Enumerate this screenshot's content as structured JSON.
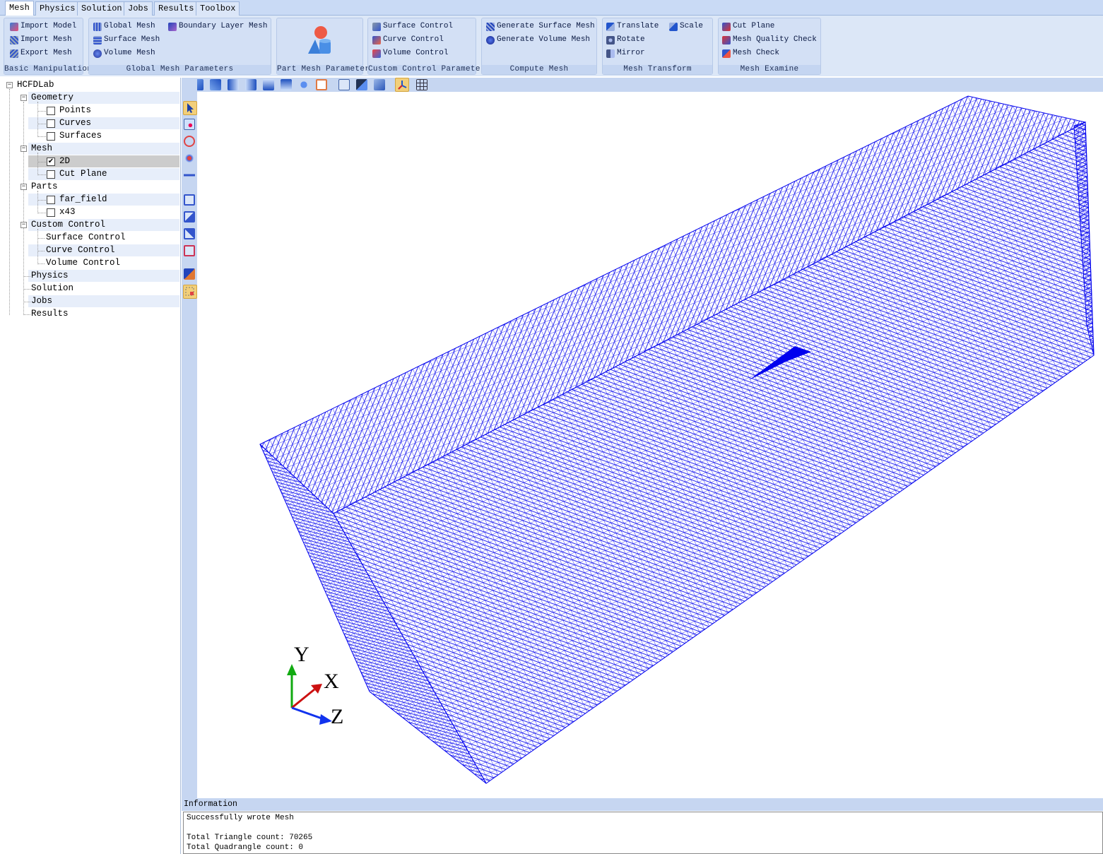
{
  "tabs": [
    "Mesh",
    "Physics",
    "Solution",
    "Jobs",
    "Results",
    "Toolbox"
  ],
  "ribbon": {
    "basic": {
      "title": "Basic Manipulation",
      "import_model": "Import Model",
      "import_mesh": "Import Mesh",
      "export_mesh": "Export Mesh"
    },
    "global": {
      "title": "Global Mesh Parameters",
      "global_mesh": "Global Mesh",
      "boundary_layer_mesh": "Boundary Layer Mesh",
      "surface_mesh": "Surface Mesh",
      "volume_mesh": "Volume Mesh"
    },
    "part": {
      "title": "Part Mesh Parameters"
    },
    "custom": {
      "title": "Custom Control Parameters",
      "surface_control": "Surface Control",
      "curve_control": "Curve Control",
      "volume_control": "Volume Control"
    },
    "compute": {
      "title": "Compute Mesh",
      "generate_surface_mesh": "Generate Surface Mesh",
      "generate_volume_mesh": "Generate Volume Mesh"
    },
    "transform": {
      "title": "Mesh Transform",
      "translate": "Translate",
      "scale": "Scale",
      "rotate": "Rotate",
      "mirror": "Mirror"
    },
    "examine": {
      "title": "Mesh Examine",
      "cut_plane": "Cut Plane",
      "mesh_quality_check": "Mesh Quality Check",
      "mesh_check": "Mesh Check"
    }
  },
  "tree": {
    "root": "HCFDLab",
    "geometry": "Geometry",
    "points": "Points",
    "curves": "Curves",
    "surfaces": "Surfaces",
    "mesh": "Mesh",
    "mesh_2d": "2D",
    "cut_plane": "Cut Plane",
    "parts": "Parts",
    "far_field": "far_field",
    "x43": "x43",
    "custom_control": "Custom Control",
    "surface_control": "Surface Control",
    "curve_control": "Curve Control",
    "volume_control": "Volume Control",
    "physics": "Physics",
    "solution": "Solution",
    "jobs": "Jobs",
    "results": "Results"
  },
  "checked": {
    "mesh_2d": true,
    "points": false,
    "curves": false,
    "surfaces": false,
    "cut_plane": false,
    "far_field": false,
    "x43": false
  },
  "axes": {
    "x": "X",
    "y": "Y",
    "z": "Z"
  },
  "colors": {
    "mesh": "#0000ee",
    "axis_x": "#cc1111",
    "axis_y": "#11aa11",
    "axis_z": "#1133ee"
  },
  "info": {
    "title": "Information",
    "text": "Successfully wrote Mesh\n\nTotal Triangle count: 70265\nTotal Quadrangle count: 0"
  }
}
